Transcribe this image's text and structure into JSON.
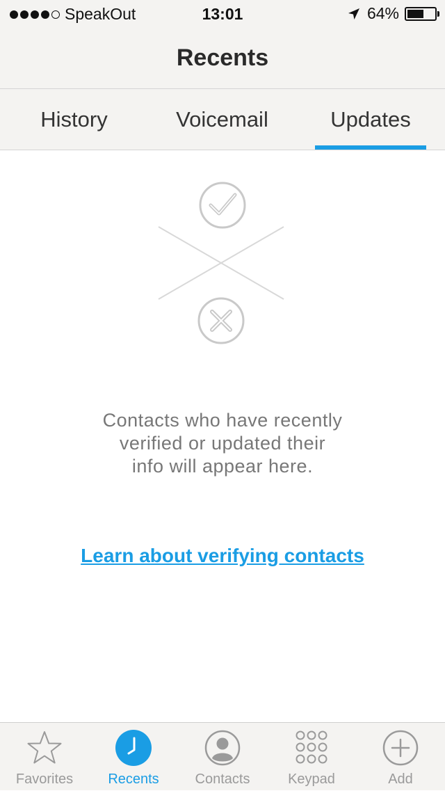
{
  "status_bar": {
    "carrier": "SpeakOut",
    "time": "13:01",
    "battery": "64%",
    "battery_level": 0.64,
    "signal_bars_filled": 4,
    "signal_bars_total": 5
  },
  "nav": {
    "title": "Recents"
  },
  "segments": {
    "items": [
      {
        "label": "History"
      },
      {
        "label": "Voicemail"
      },
      {
        "label": "Updates"
      }
    ],
    "selected": "Updates"
  },
  "empty_state": {
    "illustration": [
      "check-circle-icon",
      "x-circle-icon"
    ],
    "message_lines": [
      "Contacts who have recently",
      "verified or updated their",
      "info will appear here."
    ],
    "link": "Learn about verifying contacts"
  },
  "tab_bar": {
    "items": [
      {
        "label": "Favorites",
        "icon": "star-icon"
      },
      {
        "label": "Recents",
        "icon": "clock-icon"
      },
      {
        "label": "Contacts",
        "icon": "person-icon"
      },
      {
        "label": "Keypad",
        "icon": "keypad-icon"
      },
      {
        "label": "Add",
        "icon": "plus-icon"
      }
    ],
    "active": "Recents"
  },
  "colors": {
    "accent": "#1a9de4",
    "bar_background": "#f4f3f1",
    "muted_text": "#777777",
    "inactive_icon": "#9a9a9a"
  }
}
